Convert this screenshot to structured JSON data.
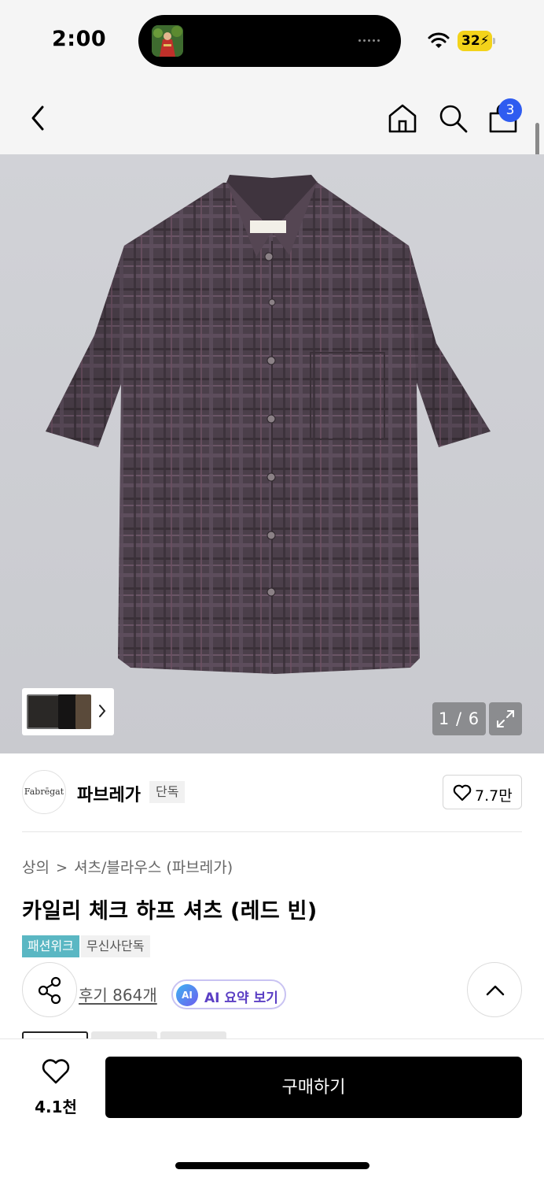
{
  "status_bar": {
    "time": "2:00",
    "battery": "32"
  },
  "nav": {
    "cart_count": "3"
  },
  "gallery": {
    "counter": "1 / 6"
  },
  "brand": {
    "logo_text": "Fabrēgat",
    "name": "파브레가",
    "tag": "단독",
    "like_count": "7.7만"
  },
  "product": {
    "breadcrumb": [
      "상의",
      "셔츠/블라우스 (파브레가)"
    ],
    "title": "카일리 체크 하프 셔츠 (레드 빈)",
    "tags": [
      "패션위크",
      "무신사단독"
    ],
    "reviews": "후기 864개",
    "ai_badge": "AI",
    "ai_summary": "AI 요약 보기"
  },
  "bottom_bar": {
    "wish_count": "4.1천",
    "buy_label": "구매하기"
  },
  "colors": {
    "accent_teal": "#5ab7c3",
    "cart_badge": "#2f5cf0",
    "ai_purple": "#5b3fc4",
    "shirt": "#4a3e48"
  },
  "icons": [
    "back-icon",
    "home-icon",
    "search-icon",
    "cart-icon",
    "expand-icon",
    "heart-icon",
    "share-icon",
    "chevron-up-icon",
    "wifi-icon"
  ]
}
